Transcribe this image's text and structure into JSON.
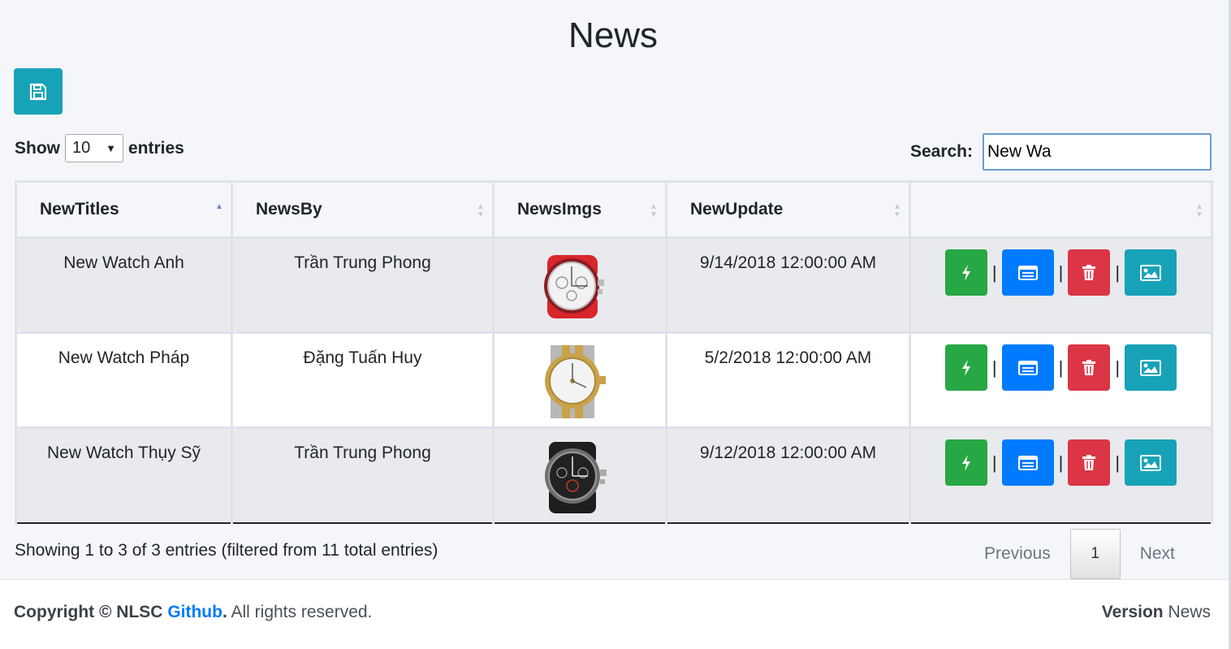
{
  "page": {
    "title": "News"
  },
  "toolbar": {
    "save_icon": "save-icon"
  },
  "length": {
    "show_label": "Show",
    "value": "10",
    "entries_label": "entries"
  },
  "search": {
    "label": "Search:",
    "value": "New Wa"
  },
  "table": {
    "headers": [
      "NewTitles",
      "NewsBy",
      "NewsImgs",
      "NewUpdate",
      ""
    ],
    "rows": [
      {
        "title": "New Watch Anh",
        "by": "Trần Trung Phong",
        "img": "watch-red-icon",
        "update": "9/14/2018 12:00:00 AM"
      },
      {
        "title": "New Watch Pháp",
        "by": "Đặng Tuấn Huy",
        "img": "watch-gold-icon",
        "update": "5/2/2018 12:00:00 AM"
      },
      {
        "title": "New Watch Thụy Sỹ",
        "by": "Trần Trung Phong",
        "img": "watch-black-icon",
        "update": "9/12/2018 12:00:00 AM"
      }
    ],
    "actions": [
      "bolt-icon",
      "list-icon",
      "trash-icon",
      "image-icon"
    ],
    "separator": "|"
  },
  "info": {
    "text": "Showing 1 to 3 of 3 entries (filtered from 11 total entries)"
  },
  "pagination": {
    "previous": "Previous",
    "current": "1",
    "next": "Next"
  },
  "footer": {
    "copyright": "Copyright © NLSC",
    "link": "Github",
    "suffix": ". All rights reserved.",
    "version_label": "Version",
    "version_value": "News"
  },
  "colors": {
    "green": "#28a745",
    "blue": "#007bff",
    "red": "#dc3545",
    "teal": "#17a2b8",
    "accent_link": "#007bff"
  }
}
